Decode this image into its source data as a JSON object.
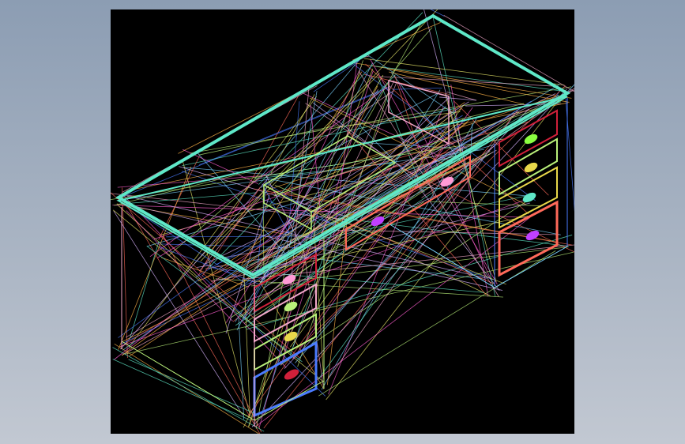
{
  "viewport": {
    "background": "#000000",
    "page_gradient": [
      "#8c9db3",
      "#c2c8d2"
    ],
    "subject": "wireframe-desk-model",
    "wire_colors": [
      "#5fe8c8",
      "#f2a7c9",
      "#b9f07a",
      "#e8e86a",
      "#ff5fd0",
      "#4a7bff",
      "#ff6a5a",
      "#d9b3ff",
      "#7ad3ff",
      "#ffb347"
    ],
    "top_color": "#5fe8c8",
    "handle_colors": [
      "#ff9ad5",
      "#b9f07a",
      "#e8d84a",
      "#d0203a",
      "#5fe8c8",
      "#8cff40",
      "#c040ff"
    ]
  }
}
